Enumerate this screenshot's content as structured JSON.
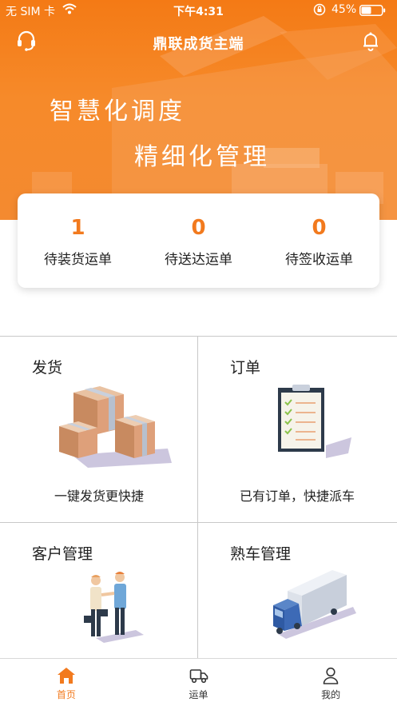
{
  "status_bar": {
    "carrier": "无 SIM 卡",
    "time": "下午4:31",
    "battery_percent": "45%"
  },
  "header": {
    "title": "鼎联成货主端",
    "left_icon": "headset-icon",
    "right_icon": "bell-icon"
  },
  "banner": {
    "slogan_line1": "智慧化调度",
    "slogan_line2": "精细化管理"
  },
  "stats": [
    {
      "value": "1",
      "label": "待装货运单"
    },
    {
      "value": "0",
      "label": "待送达运单"
    },
    {
      "value": "0",
      "label": "待签收运单"
    }
  ],
  "features": {
    "ship": {
      "title": "发货",
      "subtitle": "一键发货更快捷",
      "icon": "boxes-icon"
    },
    "order": {
      "title": "订单",
      "subtitle": "已有订单，快捷派车",
      "icon": "clipboard-icon"
    },
    "customers": {
      "title": "客户管理",
      "icon": "handshake-icon"
    },
    "trucks": {
      "title": "熟车管理",
      "icon": "truck-icon"
    }
  },
  "tabbar": {
    "items": [
      {
        "label": "首页",
        "icon": "home-icon",
        "active": true
      },
      {
        "label": "运单",
        "icon": "truck-icon",
        "active": false
      },
      {
        "label": "我的",
        "icon": "user-icon",
        "active": false
      }
    ]
  },
  "colors": {
    "accent": "#f27a1e",
    "header": "#f47a15",
    "divider": "#c8c8c8"
  }
}
